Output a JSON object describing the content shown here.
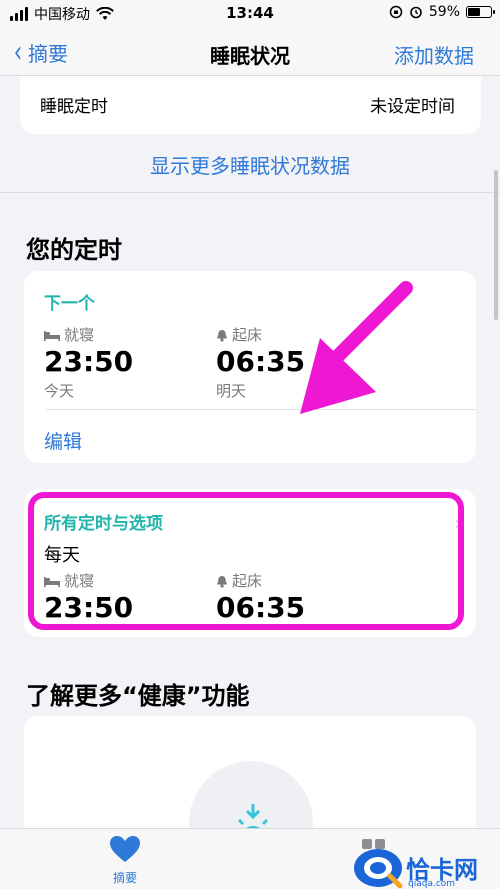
{
  "status_bar": {
    "carrier": "中国移动",
    "time": "13:44",
    "battery_percent": "59%",
    "battery_level": 0.59
  },
  "nav": {
    "back_label": "摘要",
    "title": "睡眠状况",
    "action_label": "添加数据"
  },
  "top_card": {
    "label": "睡眠定时",
    "value": "未设定时间"
  },
  "show_more": "显示更多睡眠状况数据",
  "schedule_section": {
    "title": "您的定时",
    "next_card": {
      "header": "下一个",
      "bedtime_label": "就寝",
      "bedtime_time": "23:50",
      "bedtime_day": "今天",
      "wake_label": "起床",
      "wake_time": "06:35",
      "wake_day": "明天",
      "edit_label": "编辑"
    },
    "all_card": {
      "header": "所有定时与选项",
      "frequency": "每天",
      "bedtime_label": "就寝",
      "bedtime_time": "23:50",
      "wake_label": "起床",
      "wake_time": "06:35"
    }
  },
  "learn_section": {
    "title": "了解更多“健康”功能"
  },
  "tab_bar": {
    "summary_label": "摘要"
  },
  "watermark": {
    "brand": "恰卡网",
    "url": "qiaqa.com"
  },
  "colors": {
    "accent_blue": "#2f7ad8",
    "teal": "#22b5ad",
    "highlight_magenta": "#ee17d4"
  }
}
